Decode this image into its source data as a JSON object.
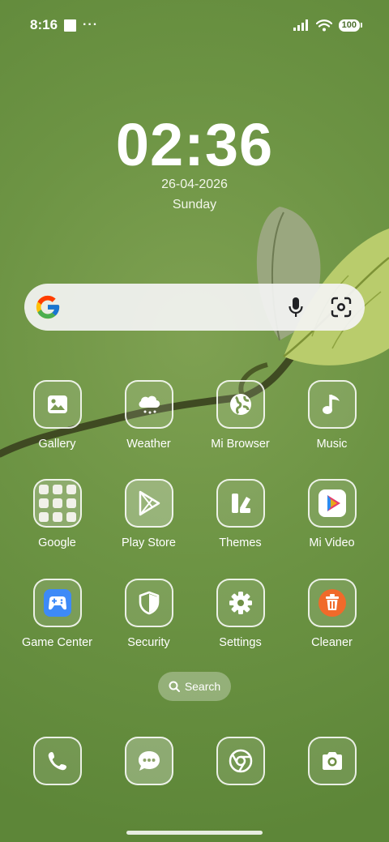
{
  "status_bar": {
    "time": "8:16",
    "dots": "···",
    "battery": "100"
  },
  "clock": {
    "time": "02:36",
    "date": "26-04-2026",
    "day": "Sunday"
  },
  "search_bar": {
    "logo": "google-g-icon",
    "mic": "mic-icon",
    "lens": "lens-icon"
  },
  "apps": [
    {
      "label": "Gallery",
      "icon": "image-icon"
    },
    {
      "label": "Weather",
      "icon": "cloud-icon"
    },
    {
      "label": "Mi Browser",
      "icon": "globe-icon"
    },
    {
      "label": "Music",
      "icon": "music-note-icon"
    },
    {
      "label": "Google",
      "icon": "folder-icon"
    },
    {
      "label": "Play Store",
      "icon": "play-triangle-icon"
    },
    {
      "label": "Themes",
      "icon": "themes-icon"
    },
    {
      "label": "Mi Video",
      "icon": "play-video-icon"
    },
    {
      "label": "Game Center",
      "icon": "gamepad-icon"
    },
    {
      "label": "Security",
      "icon": "shield-icon"
    },
    {
      "label": "Settings",
      "icon": "gear-icon"
    },
    {
      "label": "Cleaner",
      "icon": "trash-icon"
    }
  ],
  "search_pill": {
    "label": "Search",
    "icon": "search-icon"
  },
  "dock": [
    {
      "name": "phone",
      "icon": "phone-icon"
    },
    {
      "name": "messages",
      "icon": "chat-icon"
    },
    {
      "name": "chrome",
      "icon": "chrome-icon"
    },
    {
      "name": "camera",
      "icon": "camera-icon"
    }
  ],
  "colors": {
    "wallpaper": "#6d9444",
    "leaf_light": "#c8d88a",
    "cleaner_bg": "#f06a2a",
    "game_center_bg": "#3d8af7"
  }
}
